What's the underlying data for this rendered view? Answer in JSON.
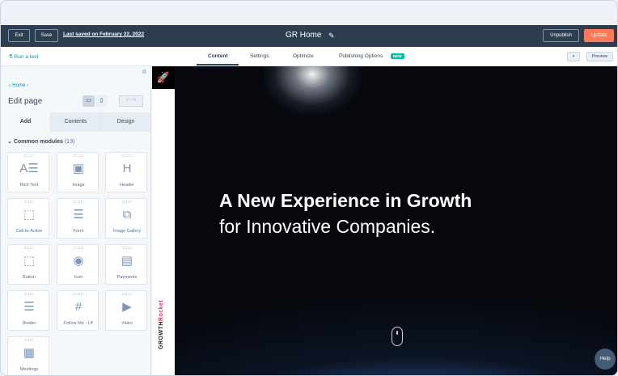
{
  "topbar": {
    "exit_label": "Exit",
    "save_label": "Save",
    "last_saved": "Last saved on February 22, 2022",
    "page_title": "GR Home",
    "unpublish_label": "Unpublish",
    "update_label": "Update",
    "update_color": "#ff7a59"
  },
  "subbar": {
    "run_test": "Run a test",
    "tabs": [
      {
        "label": "Content"
      },
      {
        "label": "Settings"
      },
      {
        "label": "Optimize"
      },
      {
        "label": "Publishing Options"
      }
    ],
    "new_badge": "NEW",
    "preview_label": "Preview"
  },
  "panel": {
    "breadcrumb": "Home",
    "title": "Edit page",
    "tabs": [
      {
        "label": "Add"
      },
      {
        "label": "Contents"
      },
      {
        "label": "Design"
      }
    ],
    "section_title": "Common modules",
    "section_count": "(13)",
    "modules": [
      {
        "label": "Rich Text",
        "icon": "rich-text-icon"
      },
      {
        "label": "Image",
        "icon": "image-icon"
      },
      {
        "label": "Header",
        "icon": "header-icon"
      },
      {
        "label": "Call-to-Action",
        "icon": "cta-icon"
      },
      {
        "label": "Form",
        "icon": "form-icon"
      },
      {
        "label": "Image Gallery",
        "icon": "gallery-icon"
      },
      {
        "label": "Button",
        "icon": "button-icon"
      },
      {
        "label": "Icon",
        "icon": "icon-module-icon"
      },
      {
        "label": "Payments",
        "icon": "payments-icon"
      },
      {
        "label": "Divider",
        "icon": "divider-icon"
      },
      {
        "label": "Follow Me - LP",
        "icon": "follow-me-icon"
      },
      {
        "label": "Video",
        "icon": "video-icon"
      },
      {
        "label": "Meetings",
        "icon": "meetings-icon"
      }
    ]
  },
  "preview": {
    "headline": "A New Experience in Growth",
    "subline": "for Innovative Companies.",
    "brand": "GROWTH",
    "brand_accent": "Rocket",
    "brand_accent_color": "#e3345a"
  },
  "help_label": "Help"
}
